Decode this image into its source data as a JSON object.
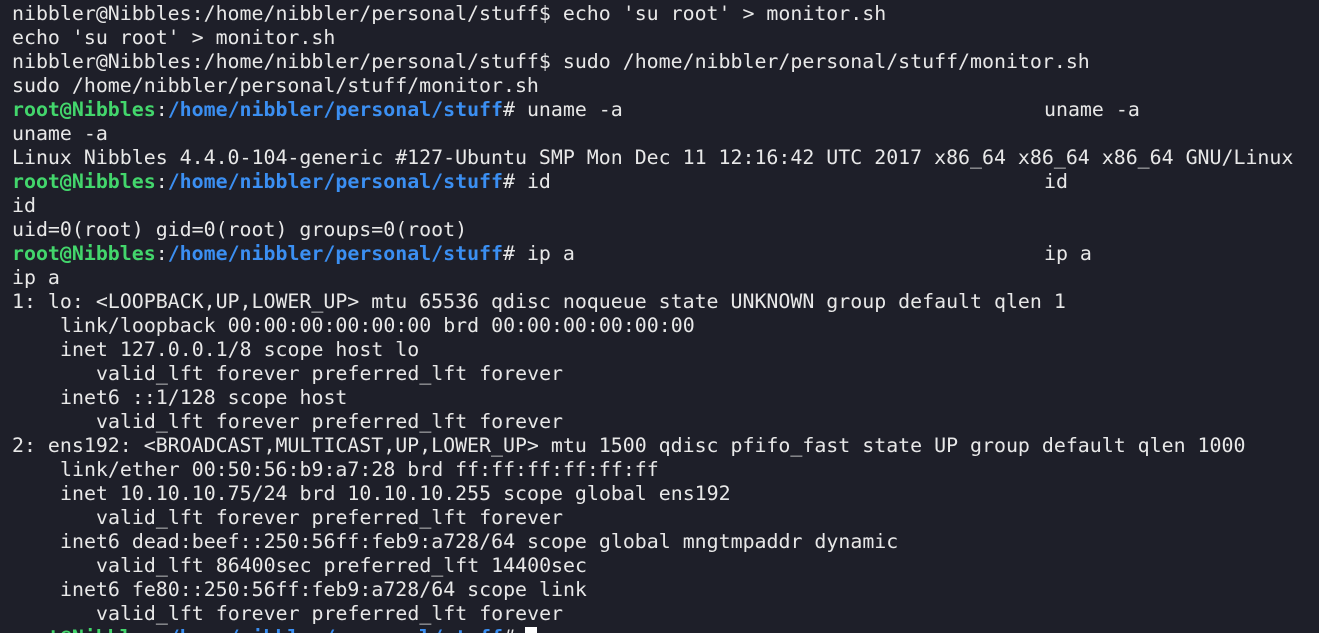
{
  "theme": {
    "background": "#1e1f29",
    "text": "#e8e8e8",
    "prompt_user_color": "#43d66c",
    "prompt_path_color": "#3b8ff2",
    "cursor_color": "#ffffff"
  },
  "prompt": {
    "user_host": "root@Nibbles",
    "colon": ":",
    "path": "/home/nibbler/personal/stuff",
    "hash": "#"
  },
  "lines": {
    "l1": "nibbler@Nibbles:/home/nibbler/personal/stuff$ echo 'su root' > monitor.sh",
    "l2": "echo 'su root' > monitor.sh",
    "l3": "nibbler@Nibbles:/home/nibbler/personal/stuff$ sudo /home/nibbler/personal/stuff/monitor.sh",
    "l4": "sudo /home/nibbler/personal/stuff/monitor.sh",
    "l5_cmd": " uname -a",
    "l5_echo": "uname -a",
    "l6": "uname -a",
    "l7": "Linux Nibbles 4.4.0-104-generic #127-Ubuntu SMP Mon Dec 11 12:16:42 UTC 2017 x86_64 x86_64 x86_64 GNU/Linux",
    "l8_cmd": " id",
    "l8_echo": "id",
    "l9": "id",
    "l10": "uid=0(root) gid=0(root) groups=0(root)",
    "l11_cmd": " ip a",
    "l11_echo": "ip a",
    "l12": "ip a",
    "l13": "1: lo: <LOOPBACK,UP,LOWER_UP> mtu 65536 qdisc noqueue state UNKNOWN group default qlen 1",
    "l14": "link/loopback 00:00:00:00:00:00 brd 00:00:00:00:00:00",
    "l15": "inet 127.0.0.1/8 scope host lo",
    "l16": "valid_lft forever preferred_lft forever",
    "l17": "inet6 ::1/128 scope host",
    "l18": "valid_lft forever preferred_lft forever",
    "l19": "2: ens192: <BROADCAST,MULTICAST,UP,LOWER_UP> mtu 1500 qdisc pfifo_fast state UP group default qlen 1000",
    "l20": "link/ether 00:50:56:b9:a7:28 brd ff:ff:ff:ff:ff:ff",
    "l21": "inet 10.10.10.75/24 brd 10.10.10.255 scope global ens192",
    "l22": "valid_lft forever preferred_lft forever",
    "l23": "inet6 dead:beef::250:56ff:feb9:a728/64 scope global mngtmpaddr dynamic",
    "l24": "valid_lft 86400sec preferred_lft 14400sec",
    "l25": "inet6 fe80::250:56ff:feb9:a728/64 scope link",
    "l26": "valid_lft forever preferred_lft forever"
  }
}
